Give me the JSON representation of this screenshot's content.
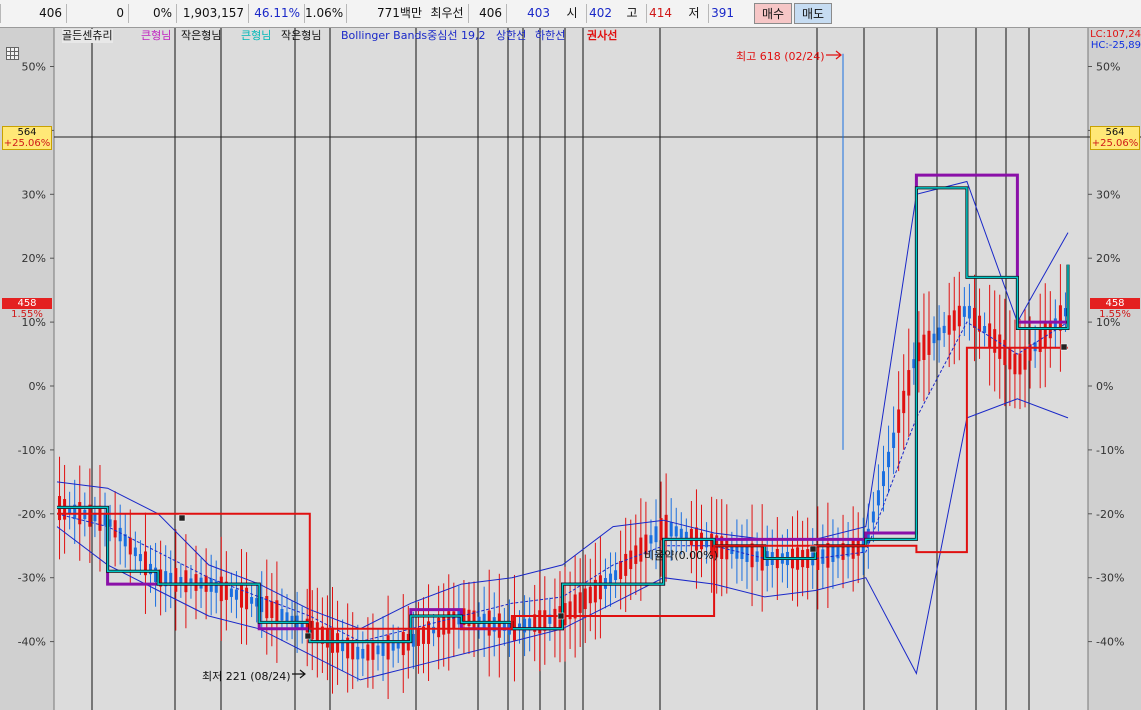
{
  "topbar": {
    "cells": [
      "406",
      "0",
      "0%",
      "1,903,157",
      "46.11%",
      "1.06%",
      "771백만"
    ],
    "best_label": "최우선",
    "best_value": "406",
    "best_value2": "403",
    "open_label": "시",
    "open_value": "402",
    "high_label": "고",
    "high_value": "414",
    "low_label": "저",
    "low_value": "391",
    "buy_label": "매수",
    "sell_label": "매도"
  },
  "legend": {
    "items": [
      {
        "text": "골든센츄리",
        "color": "#111111"
      },
      {
        "text": "큰형님",
        "color": "#c020c0"
      },
      {
        "text": "작은형님",
        "color": "#111111"
      },
      {
        "text": "큰형님",
        "color": "#00c8c8"
      },
      {
        "text": "작은형님",
        "color": "#111111"
      },
      {
        "text": "Bollinger Bands중심선 19,2",
        "color": "#1a28c8"
      },
      {
        "text": "상한선",
        "color": "#1a28c8"
      },
      {
        "text": "하한선",
        "color": "#1a28c8"
      },
      {
        "text": "권사선",
        "color": "#e01010"
      }
    ]
  },
  "right_info": {
    "lc": "LC:107,24",
    "hc": "HC:-25,89"
  },
  "price_tags": {
    "high_price": "564",
    "high_pct": "+25.06%",
    "current_price": "458",
    "current_pct": "1.55%"
  },
  "annotations": {
    "max_label": "최고 618 (02/24)",
    "min_label": "최저 221 (08/24)",
    "mid_label": "비율약(0.00%)"
  },
  "colors": {
    "background": "#dcdcdc",
    "bollinger": "#1a28c8",
    "purple_line": "#8a10a8",
    "cyan_line": "#00c8c8",
    "black_line": "#111111",
    "red_line": "#e01010",
    "candle_up": "#e01010",
    "candle_down": "#1a6fe0"
  },
  "chart_data": {
    "type": "line",
    "ylabel_ticks": [
      "50%",
      "40%",
      "30%",
      "20%",
      "10%",
      "0%",
      "-10%",
      "-20%",
      "-30%",
      "-40%"
    ],
    "y_tick_values": [
      50,
      40,
      30,
      20,
      10,
      0,
      -10,
      -20,
      -30,
      -40
    ],
    "ylim": [
      -50,
      55
    ],
    "x": [
      0,
      5,
      10,
      15,
      20,
      25,
      30,
      35,
      40,
      45,
      50,
      55,
      60,
      65,
      70,
      75,
      80,
      85,
      90,
      95,
      100
    ],
    "series": [
      {
        "role": "price",
        "values": [
          -19,
          -21,
          -30,
          -31,
          -34,
          -38,
          -42,
          -40,
          -36,
          -38,
          -36,
          -30,
          -22,
          -25,
          -27,
          -27,
          -25,
          5,
          12,
          3,
          12
        ]
      },
      {
        "role": "bollinger_middle",
        "values": [
          -20,
          -22,
          -26,
          -30,
          -33,
          -36,
          -40,
          -38,
          -36,
          -34,
          -33,
          -28,
          -25,
          -25,
          -27,
          -27,
          -26,
          -5,
          10,
          5,
          10
        ]
      },
      {
        "role": "bollinger_upper",
        "values": [
          -15,
          -16,
          -20,
          -28,
          -31,
          -35,
          -38,
          -34,
          -31,
          -30,
          -28,
          -22,
          -21,
          -23,
          -24,
          -24,
          -22,
          30,
          32,
          10,
          24
        ]
      },
      {
        "role": "bollinger_lower",
        "values": [
          -22,
          -28,
          -32,
          -36,
          -38,
          -42,
          -46,
          -44,
          -42,
          -40,
          -38,
          -34,
          -30,
          -31,
          -33,
          -32,
          -30,
          -45,
          -5,
          -2,
          -5
        ]
      },
      {
        "role": "purple_step",
        "values": [
          -19,
          -31,
          -31,
          -31,
          -38,
          -40,
          -40,
          -35,
          -38,
          -38,
          -31,
          -31,
          -24,
          -24,
          -24,
          -24,
          -23,
          33,
          33,
          10,
          12
        ]
      },
      {
        "role": "cyan_step",
        "values": [
          -19,
          -29,
          -31,
          -31,
          -37,
          -40,
          -40,
          -36,
          -37,
          -38,
          -31,
          -31,
          -24,
          -25,
          -27,
          -25,
          -24,
          31,
          17,
          9,
          19
        ]
      },
      {
        "role": "red_step",
        "values": [
          -20,
          -20,
          -20,
          -20,
          -20,
          -38,
          -38,
          -38,
          -38,
          -36,
          -36,
          -36,
          -36,
          -25,
          -25,
          -25,
          -25,
          -26,
          6,
          6,
          6
        ]
      }
    ]
  }
}
